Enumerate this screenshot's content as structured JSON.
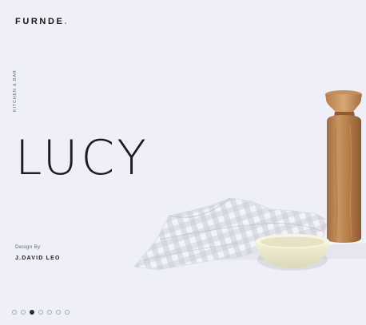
{
  "brand": {
    "name": "FURNDE",
    "dot": "."
  },
  "category": "KITCHEN & BAR",
  "product": {
    "title": "LUCY"
  },
  "credit": {
    "label": "Design By",
    "designer": "J.DAVID LEO"
  },
  "pager": {
    "count": 7,
    "active_index": 2
  },
  "colors": {
    "background": "#eff0f7",
    "accent": "#ef4b3b",
    "text": "#1a1c20"
  }
}
